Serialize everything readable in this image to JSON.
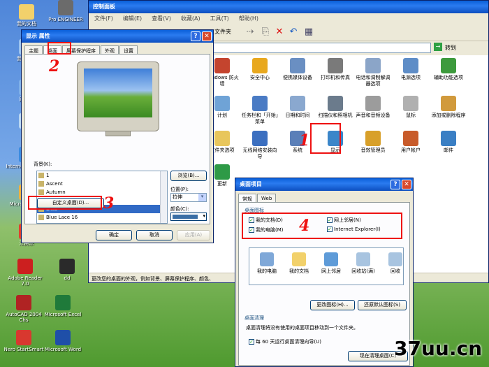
{
  "desktop_icons": [
    {
      "label": "我的文档",
      "color": "#f2d16b"
    },
    {
      "label": "我的电脑",
      "color": "#9cc3ef"
    },
    {
      "label": "网上邻",
      "color": "#7fb0e8"
    },
    {
      "label": "回收",
      "color": "#b9d7f2"
    },
    {
      "label": "Internet Explorer",
      "color": "#3a8be0"
    },
    {
      "label": "Microsoft Outl",
      "color": "#f0b23e"
    },
    {
      "label": "江民杀",
      "color": "#e23f2c"
    },
    {
      "label": "Adobe Reader 7.0",
      "color": "#cc1f1f"
    },
    {
      "label": "dd",
      "color": "#2a2a2a"
    },
    {
      "label": "AutoCAD 2004 Chs",
      "color": "#b02323"
    },
    {
      "label": "Microsoft Excel",
      "color": "#1f7a3a"
    },
    {
      "label": "Nero StartSmart",
      "color": "#d8382f"
    },
    {
      "label": "Microsoft Word",
      "color": "#1f4fa8"
    },
    {
      "label": "Pro ENGINEER",
      "color": "#6b6b6b"
    }
  ],
  "control_panel": {
    "title": "控制面板",
    "menu": [
      "文件(F)",
      "编辑(E)",
      "查看(V)",
      "收藏(A)",
      "工具(T)",
      "帮助(H)"
    ],
    "toolbar": {
      "folder_label": "文件夹"
    },
    "go_label": "转到",
    "items": [
      {
        "label": "Windows 防火墙",
        "color": "#c4442e"
      },
      {
        "label": "安全中心",
        "color": "#e8a81e"
      },
      {
        "label": "便携媒体设备",
        "color": "#6a8fc2"
      },
      {
        "label": "打印机和传真",
        "color": "#7a7a7a"
      },
      {
        "label": "电话和调制解调器选项",
        "color": "#8ba5c8"
      },
      {
        "label": "电源选项",
        "color": "#5e8dc7"
      },
      {
        "label": "辅助功能选项",
        "color": "#3c9a3c"
      },
      {
        "label": "计划",
        "color": "#6fa3d6"
      },
      {
        "label": "任务栏和「开始」菜单",
        "color": "#4a7bc4"
      },
      {
        "label": "日期和时间",
        "color": "#8aa8cf"
      },
      {
        "label": "扫描仪和照相机",
        "color": "#6b7b8c"
      },
      {
        "label": "声音和音频设备",
        "color": "#9c9c9c"
      },
      {
        "label": "鼠标",
        "color": "#b0b0b0"
      },
      {
        "label": "添加或删除程序",
        "color": "#d19a3c"
      },
      {
        "label": "文件夹选项",
        "color": "#e8c65c"
      },
      {
        "label": "无线网络安装向导",
        "color": "#3b6fc0"
      },
      {
        "label": "系统",
        "color": "#5a7fb8"
      },
      {
        "label": "显示",
        "color": "#3b86c9"
      },
      {
        "label": "音效管理员",
        "color": "#d8a02a"
      },
      {
        "label": "用户帐户",
        "color": "#c85b2a"
      },
      {
        "label": "邮件",
        "color": "#3a7fc4"
      },
      {
        "label": "更新",
        "color": "#2e9a46"
      }
    ],
    "status": "更改您的桌面的外观，例如背景、屏幕保护程序、颜色、"
  },
  "display_dialog": {
    "title": "显示 属性",
    "tabs": [
      "主题",
      "桌面",
      "屏幕保护程序",
      "外观",
      "设置"
    ],
    "background_label": "背景(K):",
    "backgrounds": [
      "1",
      "Ascent",
      "Autumn",
      "Azul",
      "Bliss",
      "Blue Lace 16"
    ],
    "selected_background": "Bliss",
    "browse_button": "浏览(B)...",
    "position_label": "位置(P):",
    "position_value": "拉伸",
    "color_label": "颜色(C):",
    "customize_button": "自定义桌面(D)...",
    "ok": "确定",
    "cancel": "取消",
    "apply": "应用(A)"
  },
  "desktop_items_dialog": {
    "title": "桌面项目",
    "tabs": [
      "常规",
      "Web"
    ],
    "icons_group_label": "桌面图标",
    "checkboxes": [
      {
        "label": "我的文档(D)",
        "checked": true
      },
      {
        "label": "网上邻居(N)",
        "checked": true
      },
      {
        "label": "我的电脑(M)",
        "checked": true
      },
      {
        "label": "Internet Explorer(I)",
        "checked": true
      }
    ],
    "icons": [
      {
        "label": "我的电脑",
        "color": "#7fa8d8"
      },
      {
        "label": "我的文档",
        "color": "#f2d16b"
      },
      {
        "label": "网上邻居",
        "color": "#5e9bd8"
      },
      {
        "label": "回收站(满)",
        "color": "#a8c4e0"
      },
      {
        "label": "回收",
        "color": "#a8c4e0"
      }
    ],
    "change_icon_button": "更改图标(H)...",
    "restore_default_button": "还原默认图标(S)",
    "cleanup_group_label": "桌面清理",
    "cleanup_text": "桌面清理将没有使用的桌面项目移动到一个文件夹。",
    "cleanup_checkbox": "每 60 天运行桌面清理向导(U)",
    "cleanup_checkbox_checked": true,
    "cleanup_now_button": "现在清理桌面(C)"
  },
  "annotations": [
    "1",
    "2",
    "3",
    "4"
  ],
  "watermark": "37uu.cn"
}
